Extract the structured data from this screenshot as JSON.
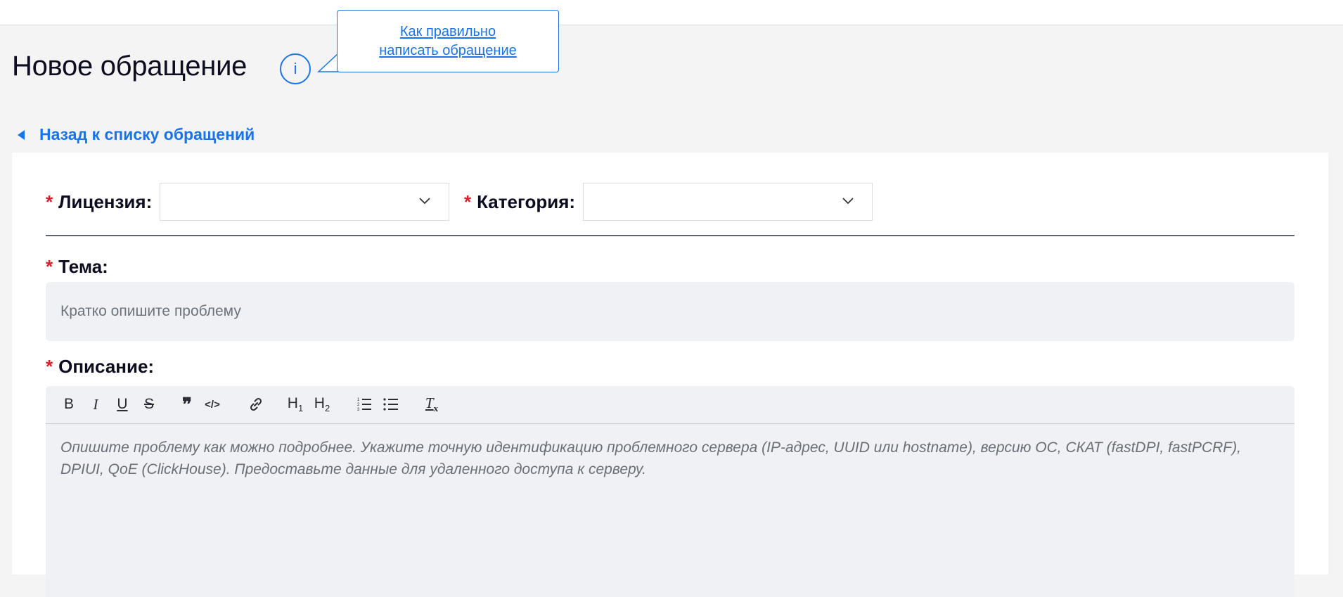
{
  "page": {
    "title": "Новое обращение",
    "info_icon": "info-circle-icon",
    "tooltip": {
      "line1": "Как правильно",
      "line2": "написать обращение"
    },
    "back_link": "Назад к списку обращений",
    "back_icon": "caret-left-icon"
  },
  "form": {
    "required_mark": "*",
    "license": {
      "label": "Лицензия:",
      "value": ""
    },
    "category": {
      "label": "Категория:",
      "value": ""
    },
    "subject": {
      "label": "Тема:",
      "placeholder": "Кратко опишите проблему",
      "value": ""
    },
    "description": {
      "label": "Описание:",
      "placeholder": "Опишите проблему как можно подробнее. Укажите точную идентификацию проблемного сервера (IP-адрес, UUID или hostname), версию ОС, СКАТ (fastDPI, fastPCRF), DPIUI, QoE (ClickHouse). Предоставьте данные для удаленного доступа к серверу.",
      "toolbar": [
        {
          "name": "bold-button",
          "icon": "bold-icon",
          "text": "B"
        },
        {
          "name": "italic-button",
          "icon": "italic-icon",
          "text": "I"
        },
        {
          "name": "underline-button",
          "icon": "underline-icon",
          "text": "U"
        },
        {
          "name": "strike-button",
          "icon": "strikethrough-icon",
          "text": "S"
        },
        {
          "name": "quote-button",
          "icon": "quote-icon",
          "text": "❞"
        },
        {
          "name": "code-button",
          "icon": "code-icon",
          "text": "</>"
        },
        {
          "name": "link-button",
          "icon": "link-icon",
          "text": ""
        },
        {
          "name": "h1-button",
          "icon": "heading1-icon",
          "text": "H",
          "sub": "1"
        },
        {
          "name": "h2-button",
          "icon": "heading2-icon",
          "text": "H",
          "sub": "2"
        },
        {
          "name": "ordered-list-button",
          "icon": "ordered-list-icon",
          "text": ""
        },
        {
          "name": "bullet-list-button",
          "icon": "bullet-list-icon",
          "text": ""
        },
        {
          "name": "clear-format-button",
          "icon": "clear-format-icon",
          "text": "T"
        }
      ]
    }
  },
  "colors": {
    "accent": "#1a73e8",
    "required": "#e11d2a",
    "background": "#f4f4f4",
    "input_bg": "#eff1f4"
  }
}
